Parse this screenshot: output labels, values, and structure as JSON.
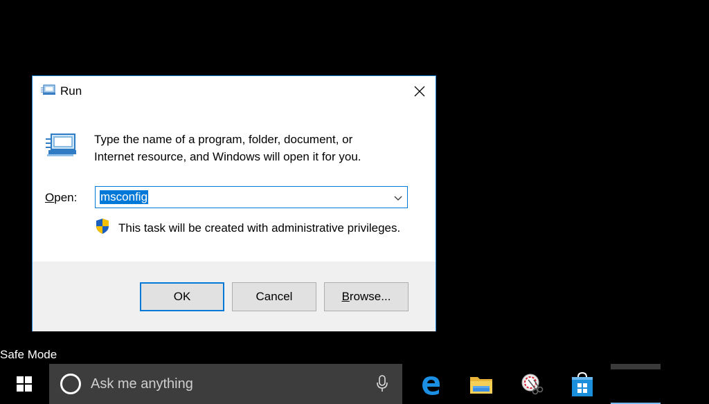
{
  "dialog": {
    "title": "Run",
    "description": "Type the name of a program, folder, document, or Internet resource, and Windows will open it for you.",
    "open_label_mnemonic": "O",
    "open_label_rest": "pen:",
    "open_value": "msconfig",
    "admin_note": "This task will be created with administrative privileges.",
    "buttons": {
      "ok": "OK",
      "cancel": "Cancel",
      "browse_mnemonic": "B",
      "browse_rest": "rowse..."
    },
    "icons": {
      "title": "run-icon",
      "main": "run-large-icon",
      "close": "close-icon",
      "dropdown": "chevron-down-icon",
      "shield": "uac-shield-icon"
    }
  },
  "desktop": {
    "mode_label": "Safe Mode"
  },
  "taskbar": {
    "search_placeholder": "Ask me anything",
    "icons": [
      "windows-start-icon",
      "cortana-icon",
      "microphone-icon",
      "edge-icon",
      "file-explorer-icon",
      "snipping-tool-icon",
      "store-icon"
    ]
  },
  "colors": {
    "accent": "#0078d7",
    "dialog_border": "#1883d7",
    "footer_bg": "#f0f0f0",
    "taskbar_search_bg": "#3d3d3d"
  }
}
